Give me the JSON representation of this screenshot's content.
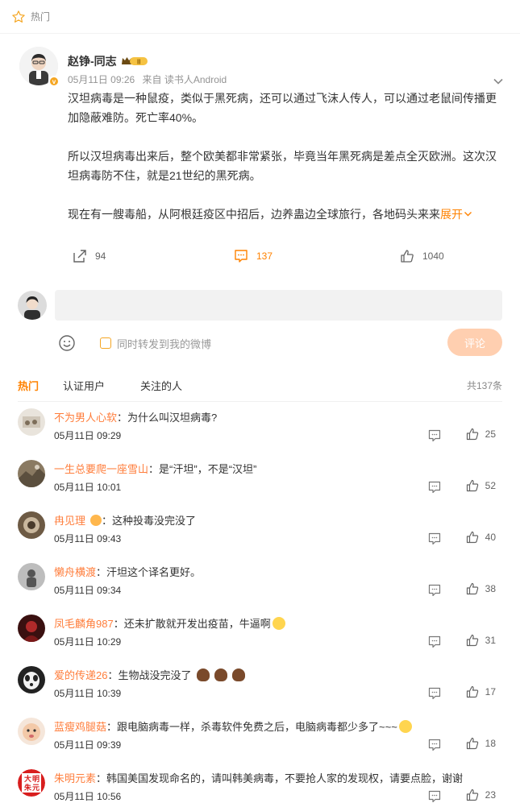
{
  "hot_label": "热门",
  "post": {
    "author": "赵铮-同志",
    "date": "05月11日 09:26",
    "source": "来自 读书人Android",
    "paragraphs": [
      "汉坦病毒是一种鼠疫，类似于黑死病，还可以通过飞沫人传人，可以通过老鼠间传播更加隐蔽难防。死亡率40%。",
      "所以汉坦病毒出来后，整个欧美都非常紧张，毕竟当年黑死病是差点全灭欧洲。这次汉坦病毒防不住，就是21世纪的黑死病。",
      "现在有一艘毒船，从阿根廷疫区中招后，边养蛊边全球旅行，各地码头来来"
    ],
    "expand": "展开",
    "shares": "94",
    "comments": "137",
    "likes": "1040"
  },
  "composer": {
    "placeholder": "",
    "repost_label": "同时转发到我的微博",
    "submit": "评论"
  },
  "tabs": [
    "热门",
    "认证用户",
    "关注的人"
  ],
  "total": "共137条",
  "comments": [
    {
      "user": "不为男人心软",
      "text": "为什么叫汉坦病毒?",
      "time": "05月11日 09:29",
      "likes": "25"
    },
    {
      "user": "一生总要爬一座雪山",
      "text": "是“汗坦”，不是“汉坦”",
      "time": "05月11日 10:01",
      "likes": "52"
    },
    {
      "user": "冉见理",
      "text": "这种投毒没完没了",
      "time": "05月11日 09:43",
      "likes": "40"
    },
    {
      "user": "懒舟横渡",
      "text": "汗坦这个译名更好。",
      "time": "05月11日 09:34",
      "likes": "38"
    },
    {
      "user": "凤毛麟角987",
      "text": "还未扩散就开发出疫苗，牛逼啊",
      "time": "05月11日 10:29",
      "likes": "31"
    },
    {
      "user": "爱的传递26",
      "text": "生物战没完没了",
      "time": "05月11日 10:39",
      "likes": "17"
    },
    {
      "user": "蓝瘦鸡腿菇",
      "text": "跟电脑病毒一样，杀毒软件免费之后，电脑病毒都少多了~~~",
      "time": "05月11日 09:39",
      "likes": "18"
    },
    {
      "user": "朱明元素",
      "text": "韩国美国发现命名的，请叫韩美病毒，不要抢人家的发现权，请要点脸，谢谢",
      "time": "05月11日 10:56",
      "likes": "23"
    }
  ],
  "colors": {
    "accent": "#ff8200",
    "username": "#ff7d3b",
    "submit_bg": "#ffcfb0"
  },
  "avatar_stamp": [
    "大",
    "明",
    "朱",
    "元"
  ]
}
